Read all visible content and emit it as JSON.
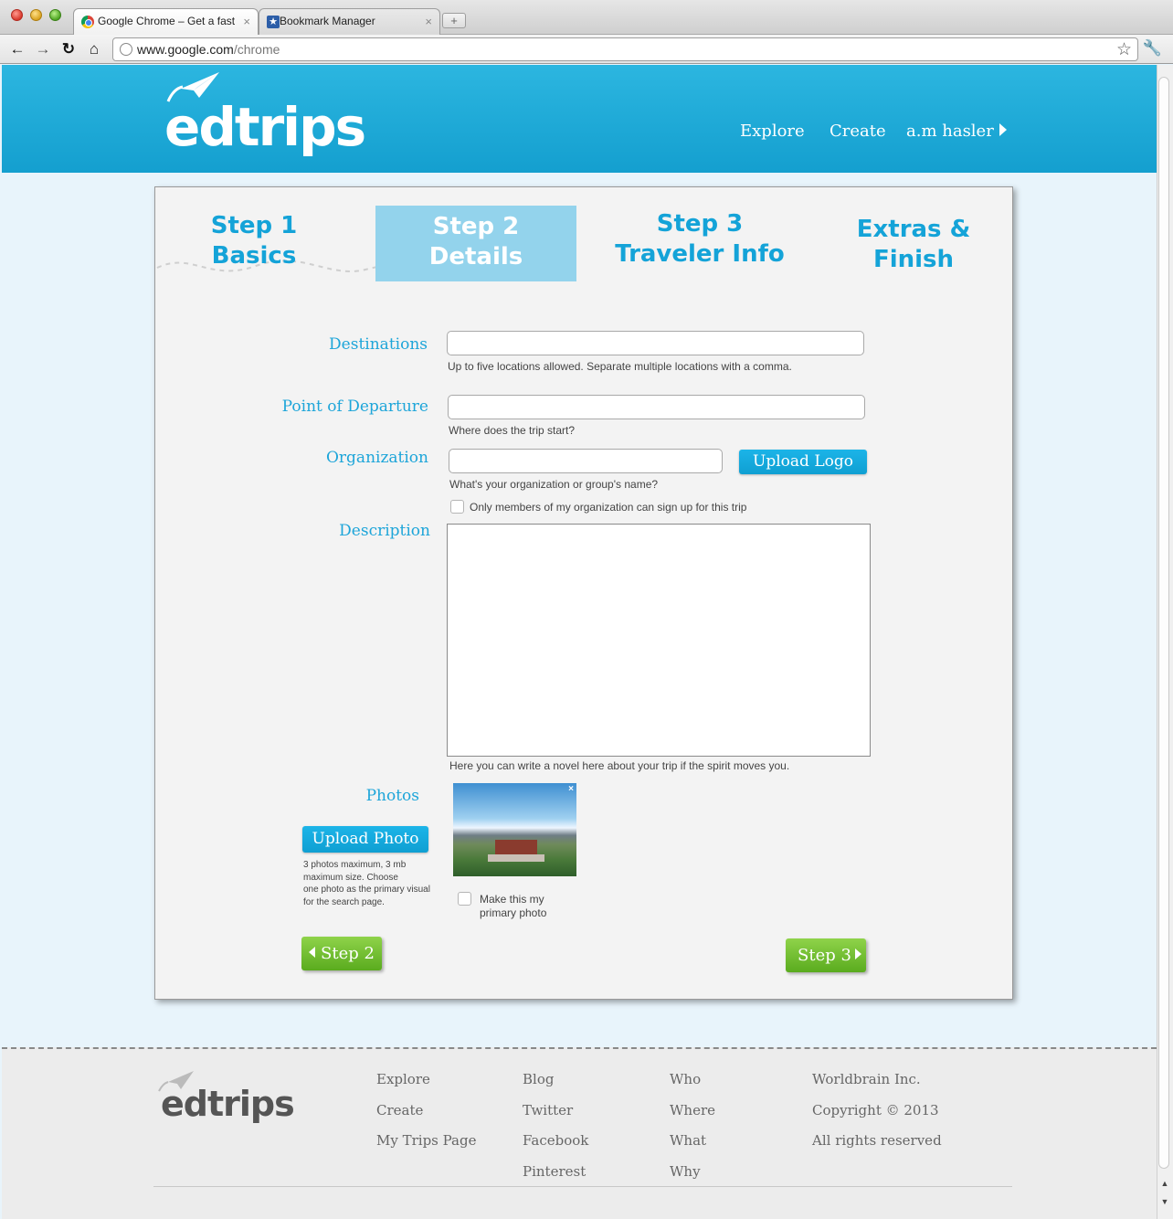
{
  "browser": {
    "tabs": [
      {
        "label": "Google Chrome – Get a fast",
        "active": true,
        "icon": "chrome-icon"
      },
      {
        "label": "Bookmark Manager",
        "active": false,
        "icon": "bookmark-star-icon"
      }
    ],
    "url_host": "www.google.com",
    "url_path": "/chrome",
    "nav_icons": [
      "back-icon",
      "forward-icon",
      "reload-icon",
      "home-icon",
      "bookmark-star-icon",
      "wrench-icon"
    ]
  },
  "header": {
    "logo": "edtrips",
    "nav": [
      "Explore",
      "Create",
      "a.m hasler"
    ]
  },
  "steps": [
    {
      "line1": "Step 1",
      "line2": "Basics",
      "active": false
    },
    {
      "line1": "Step 2",
      "line2": "Details",
      "active": true
    },
    {
      "line1": "Step 3",
      "line2": "Traveler Info",
      "active": false
    },
    {
      "line1": "Extras &",
      "line2": "Finish",
      "active": false
    }
  ],
  "form": {
    "destinations": {
      "label": "Destinations",
      "value": "",
      "hint": "Up to five locations allowed. Separate multiple locations with a comma."
    },
    "departure": {
      "label": "Point of Departure",
      "value": "",
      "hint": "Where does the trip start?"
    },
    "organization": {
      "label": "Organization",
      "value": "",
      "hint": "What's your organization or group's name?",
      "upload_label": "Upload Logo"
    },
    "members_only": {
      "label": "Only members of my organization can sign up for this trip",
      "checked": false
    },
    "description": {
      "label": "Description",
      "value": "",
      "hint": "Here you can write a novel here about your trip if the spirit moves you."
    },
    "photos": {
      "label": "Photos",
      "upload_label": "Upload Photo",
      "hint_lines": [
        "3 photos maximum, 3 mb",
        "maximum size. Choose",
        "one photo as the primary visual",
        "for the search page."
      ],
      "primary_lines": [
        "Make this my",
        "primary photo"
      ],
      "primary_checked": false,
      "remove_glyph": "×"
    },
    "prev_label": "Step 2",
    "next_label": "Step 3"
  },
  "footer": {
    "logo": "edtrips",
    "columns": [
      [
        "Explore",
        "Create",
        "My Trips Page"
      ],
      [
        "Blog",
        "Twitter",
        "Facebook",
        "Pinterest"
      ],
      [
        "Who",
        "Where",
        "What",
        "Why"
      ],
      [
        "Worldbrain Inc.",
        "Copyright © 2013",
        "All rights reserved"
      ]
    ]
  },
  "colors": {
    "header_blue": "#1ca8d8",
    "step_blue": "#14a3d8",
    "step_active_bg": "#93d3ec",
    "button_blue": "#15a8dd",
    "button_green": "#6dbb2c"
  }
}
